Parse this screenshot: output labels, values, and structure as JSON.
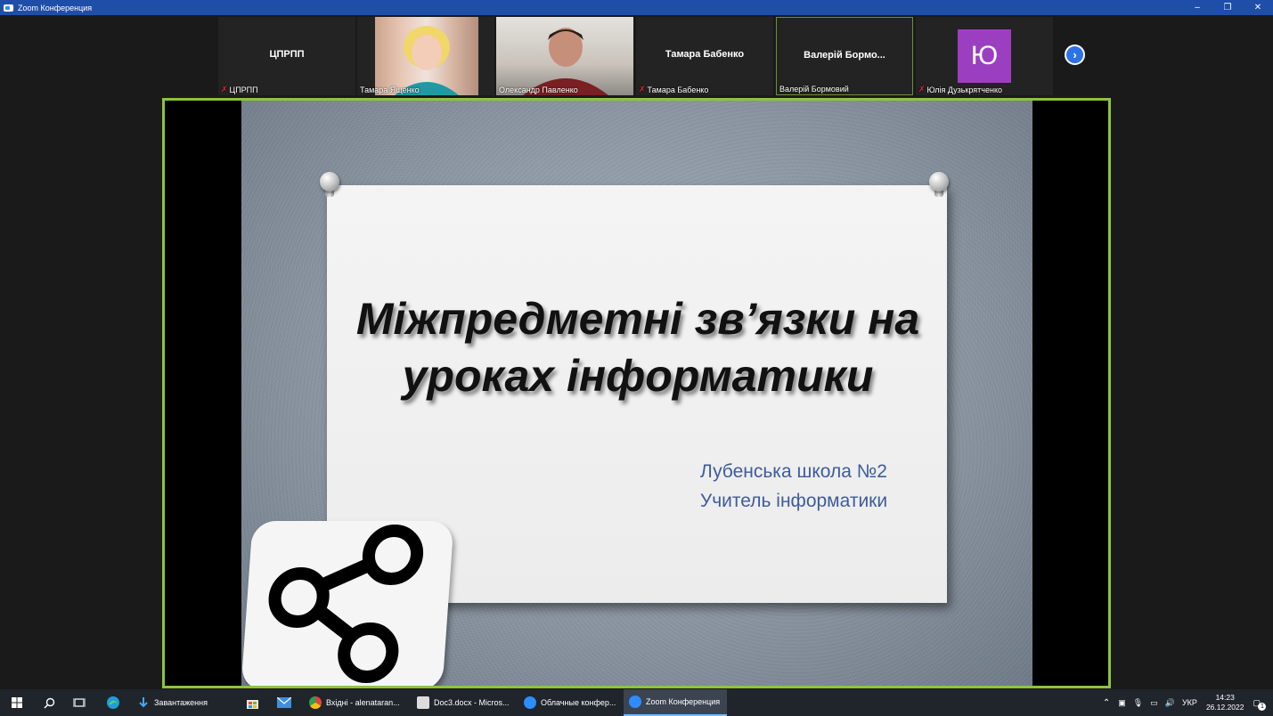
{
  "window": {
    "title": "Zoom Конференция",
    "controls": [
      "–",
      "❐",
      "✕"
    ]
  },
  "gallery": {
    "tiles": [
      {
        "bigname": "ЦПРПП",
        "label": "ЦПРПП",
        "muted": true
      },
      {
        "bigname": "",
        "label": "Тамара Ященко",
        "muted": false
      },
      {
        "bigname": "",
        "label": "Олександр Павленко",
        "muted": false
      },
      {
        "bigname": "Тамара Бабенко",
        "label": "Тамара Бабенко",
        "muted": true
      },
      {
        "bigname": "Валерій Бормо...",
        "label": "Валерій Бормовий",
        "muted": false
      },
      {
        "bigname": "",
        "avatar": "Ю",
        "label": "Юлія Дузькрятченко",
        "muted": true
      }
    ],
    "next_icon": "›"
  },
  "slide": {
    "title_line1": "Міжпредметні зв’язки  на",
    "title_line2": "уроках інформатики",
    "subtitle_line1": "Лубенська школа №2",
    "subtitle_line2": "Учитель інформатики",
    "icon": "share-icon"
  },
  "taskbar": {
    "apps": [
      {
        "label": "Завантаження",
        "icon": "download-icon"
      },
      {
        "label": "Вхідні - alenataran...",
        "icon": "chrome-icon"
      },
      {
        "label": "Doc3.docx - Micros...",
        "icon": "word-icon"
      },
      {
        "label": "Облачные конфер...",
        "icon": "zoom-icon"
      },
      {
        "label": "Zoom Конференция",
        "icon": "zoom-icon"
      }
    ],
    "language": "УКР",
    "time": "14:23",
    "date": "26.12.2022",
    "notification_count": "1"
  }
}
